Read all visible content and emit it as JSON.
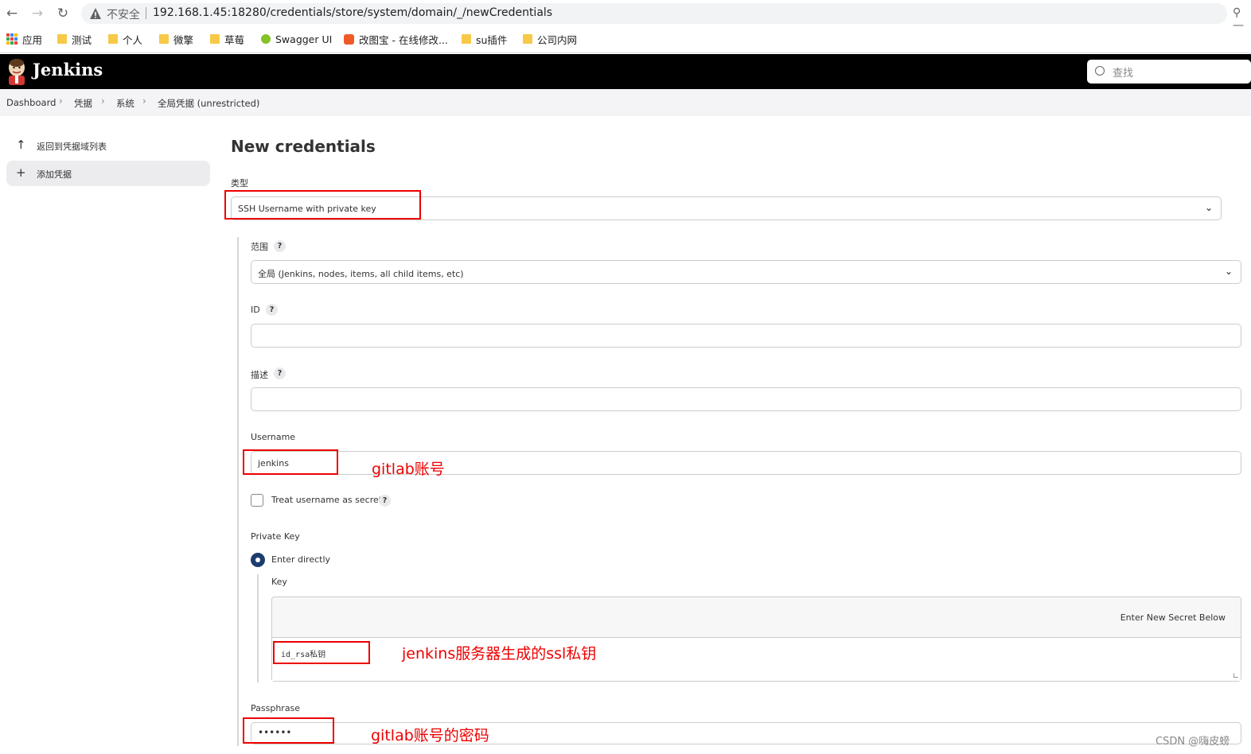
{
  "browser": {
    "insecure_label": "不安全",
    "url": "192.168.1.45:18280/credentials/store/system/domain/_/newCredentials",
    "bookmarks": [
      {
        "label": "应用"
      },
      {
        "label": "测试"
      },
      {
        "label": "个人"
      },
      {
        "label": "微擎"
      },
      {
        "label": "草莓"
      },
      {
        "label": "Swagger UI"
      },
      {
        "label": "改图宝 - 在线修改..."
      },
      {
        "label": "su插件"
      },
      {
        "label": "公司内网"
      }
    ]
  },
  "header": {
    "title": "Jenkins",
    "search_placeholder": "查找"
  },
  "breadcrumb": [
    "Dashboard",
    "凭据",
    "系统",
    "全局凭据 (unrestricted)"
  ],
  "sidebar": {
    "items": [
      {
        "label": "返回到凭据域列表",
        "icon": "arrow-up-icon"
      },
      {
        "label": "添加凭据",
        "icon": "plus-icon"
      }
    ]
  },
  "form": {
    "title": "New credentials",
    "kind_label": "类型",
    "kind_value": "SSH Username with private key",
    "scope_label": "范围",
    "scope_value": "全局 (Jenkins, nodes, items, all child items, etc)",
    "id_label": "ID",
    "id_value": "",
    "description_label": "描述",
    "description_value": "",
    "username_label": "Username",
    "username_value": "jenkins",
    "treat_secret_label": "Treat username as secret",
    "private_key_label": "Private Key",
    "enter_directly_label": "Enter directly",
    "key_label": "Key",
    "key_hint": "Enter New Secret Below",
    "key_value": "id_rsa私钥",
    "passphrase_label": "Passphrase",
    "passphrase_value": "••••••",
    "help_glyph": "?"
  },
  "annotations": {
    "username_note": "gitlab账号",
    "key_note": "jenkins服务器生成的ssl私钥",
    "passphrase_note": "gitlab账号的密码"
  },
  "watermark": "CSDN @嗨皮螃",
  "colors": {
    "header_bg": "#000000",
    "annotation": "#ee0000",
    "radio_selected": "#1d3d6e"
  }
}
